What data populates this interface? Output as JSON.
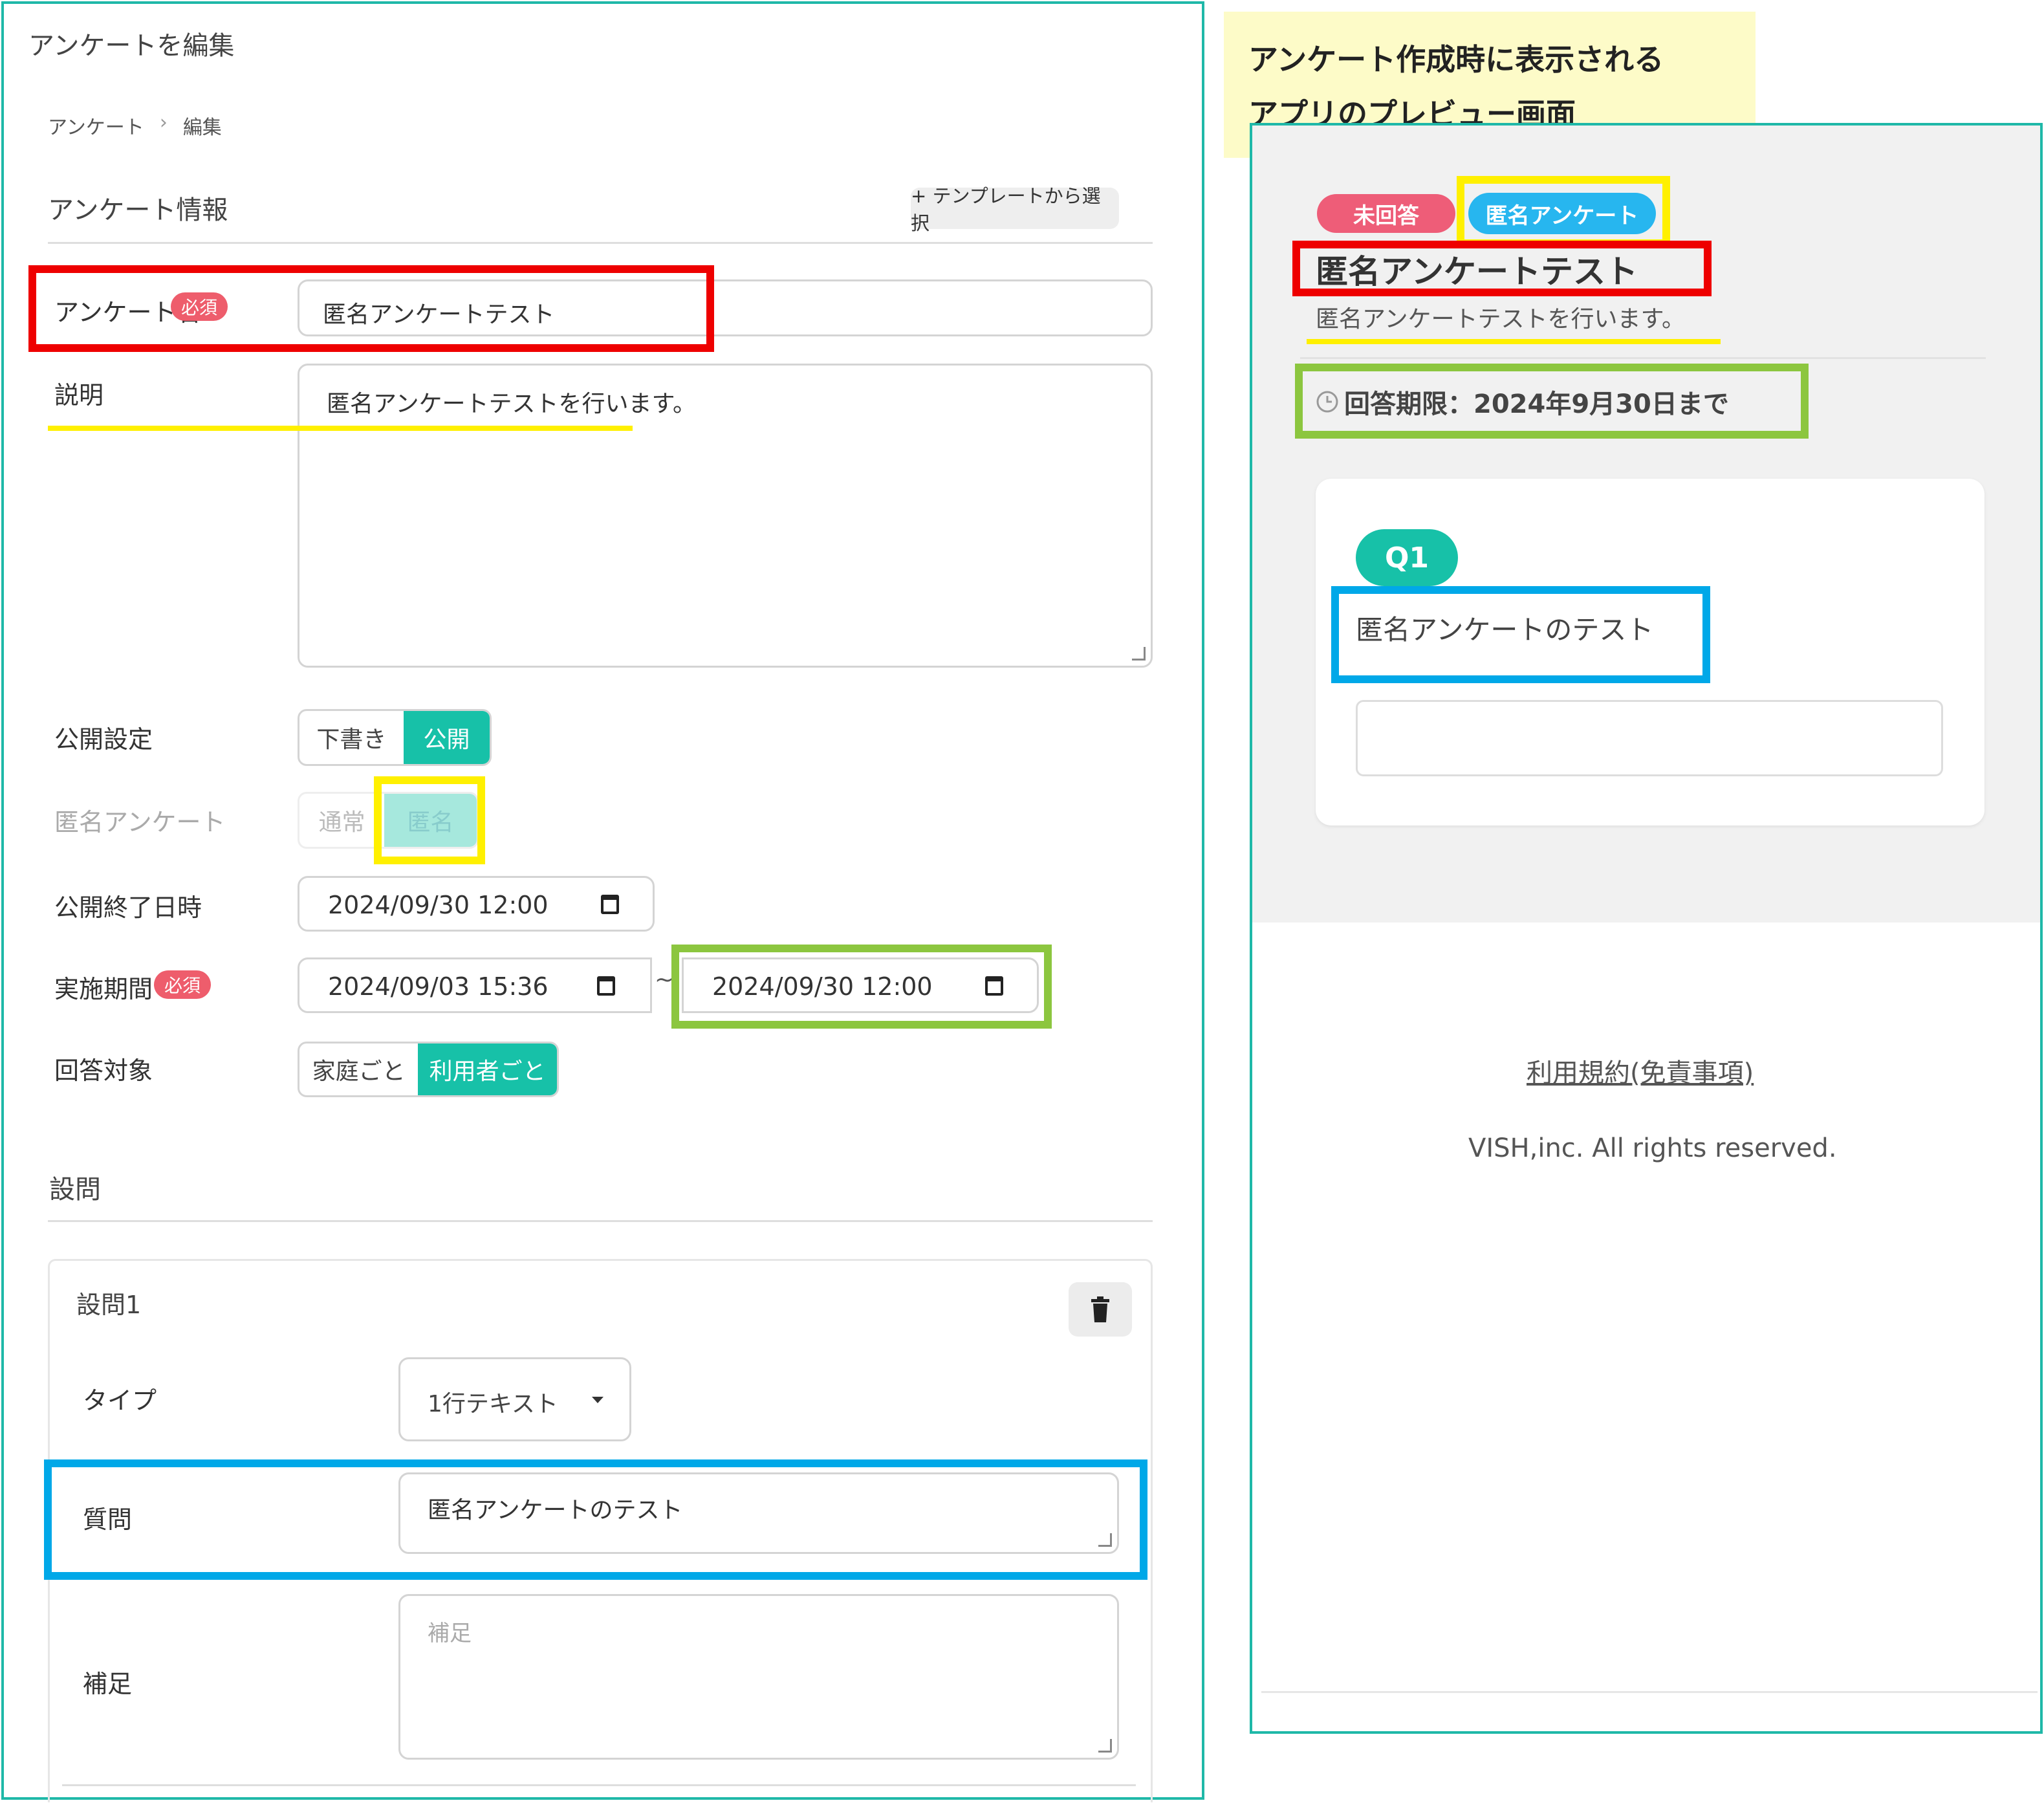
{
  "page": {
    "title": "アンケートを編集",
    "breadcrumb": {
      "parent": "アンケート",
      "sep": "›",
      "current": "編集"
    }
  },
  "survey_info": {
    "section_title": "アンケート情報",
    "template_button": "+ テンプレートから選択",
    "name_label": "アンケート名",
    "required_badge": "必須",
    "name_value": "匿名アンケートテスト",
    "description_label": "説明",
    "description_value": "匿名アンケートテストを行います。",
    "publish_label": "公開設定",
    "publish_options": [
      "下書き",
      "公開"
    ],
    "publish_selected": "公開",
    "anonymous_label": "匿名アンケート",
    "anonymous_options": [
      "通常",
      "匿名"
    ],
    "anonymous_selected": "匿名",
    "end_label": "公開終了日時",
    "end_value": "2024/09/30 12:00",
    "period_label": "実施期間",
    "period_start": "2024/09/03 15:36",
    "period_sep": "~",
    "period_end": "2024/09/30 12:00",
    "target_label": "回答対象",
    "target_options": [
      "家庭ごと",
      "利用者ごと"
    ],
    "target_selected": "利用者ごと"
  },
  "questions": {
    "section_title": "設問",
    "items": [
      {
        "title": "設問1",
        "type_label": "タイプ",
        "type_value": "1行テキスト",
        "question_label": "質問",
        "question_value": "匿名アンケートのテスト",
        "note_label": "補足",
        "note_placeholder": "補足"
      }
    ]
  },
  "annotation": {
    "line1": "アンケート作成時に表示される",
    "line2": "アプリのプレビュー画面",
    "bg": "#fdfbc8"
  },
  "preview": {
    "badge_unanswered": "未回答",
    "badge_anonymous": "匿名アンケート",
    "title": "匿名アンケートテスト",
    "description": "匿名アンケートテストを行います。",
    "deadline": "回答期限：2024年9月30日まで",
    "q_badge": "Q1",
    "q_text": "匿名アンケートのテスト",
    "terms_link": "利用規約(免責事項)",
    "copyright": "VISH,inc. All rights reserved."
  },
  "colors": {
    "accent": "#17c1a8",
    "required": "#ee5d6c",
    "highlight_red": "#ee0000",
    "highlight_yellow": "#fff000",
    "highlight_green": "#8cc63f",
    "highlight_blue": "#00a8e8",
    "badge_unanswered": "#ee5d78",
    "badge_anonymous": "#27b6ef"
  }
}
